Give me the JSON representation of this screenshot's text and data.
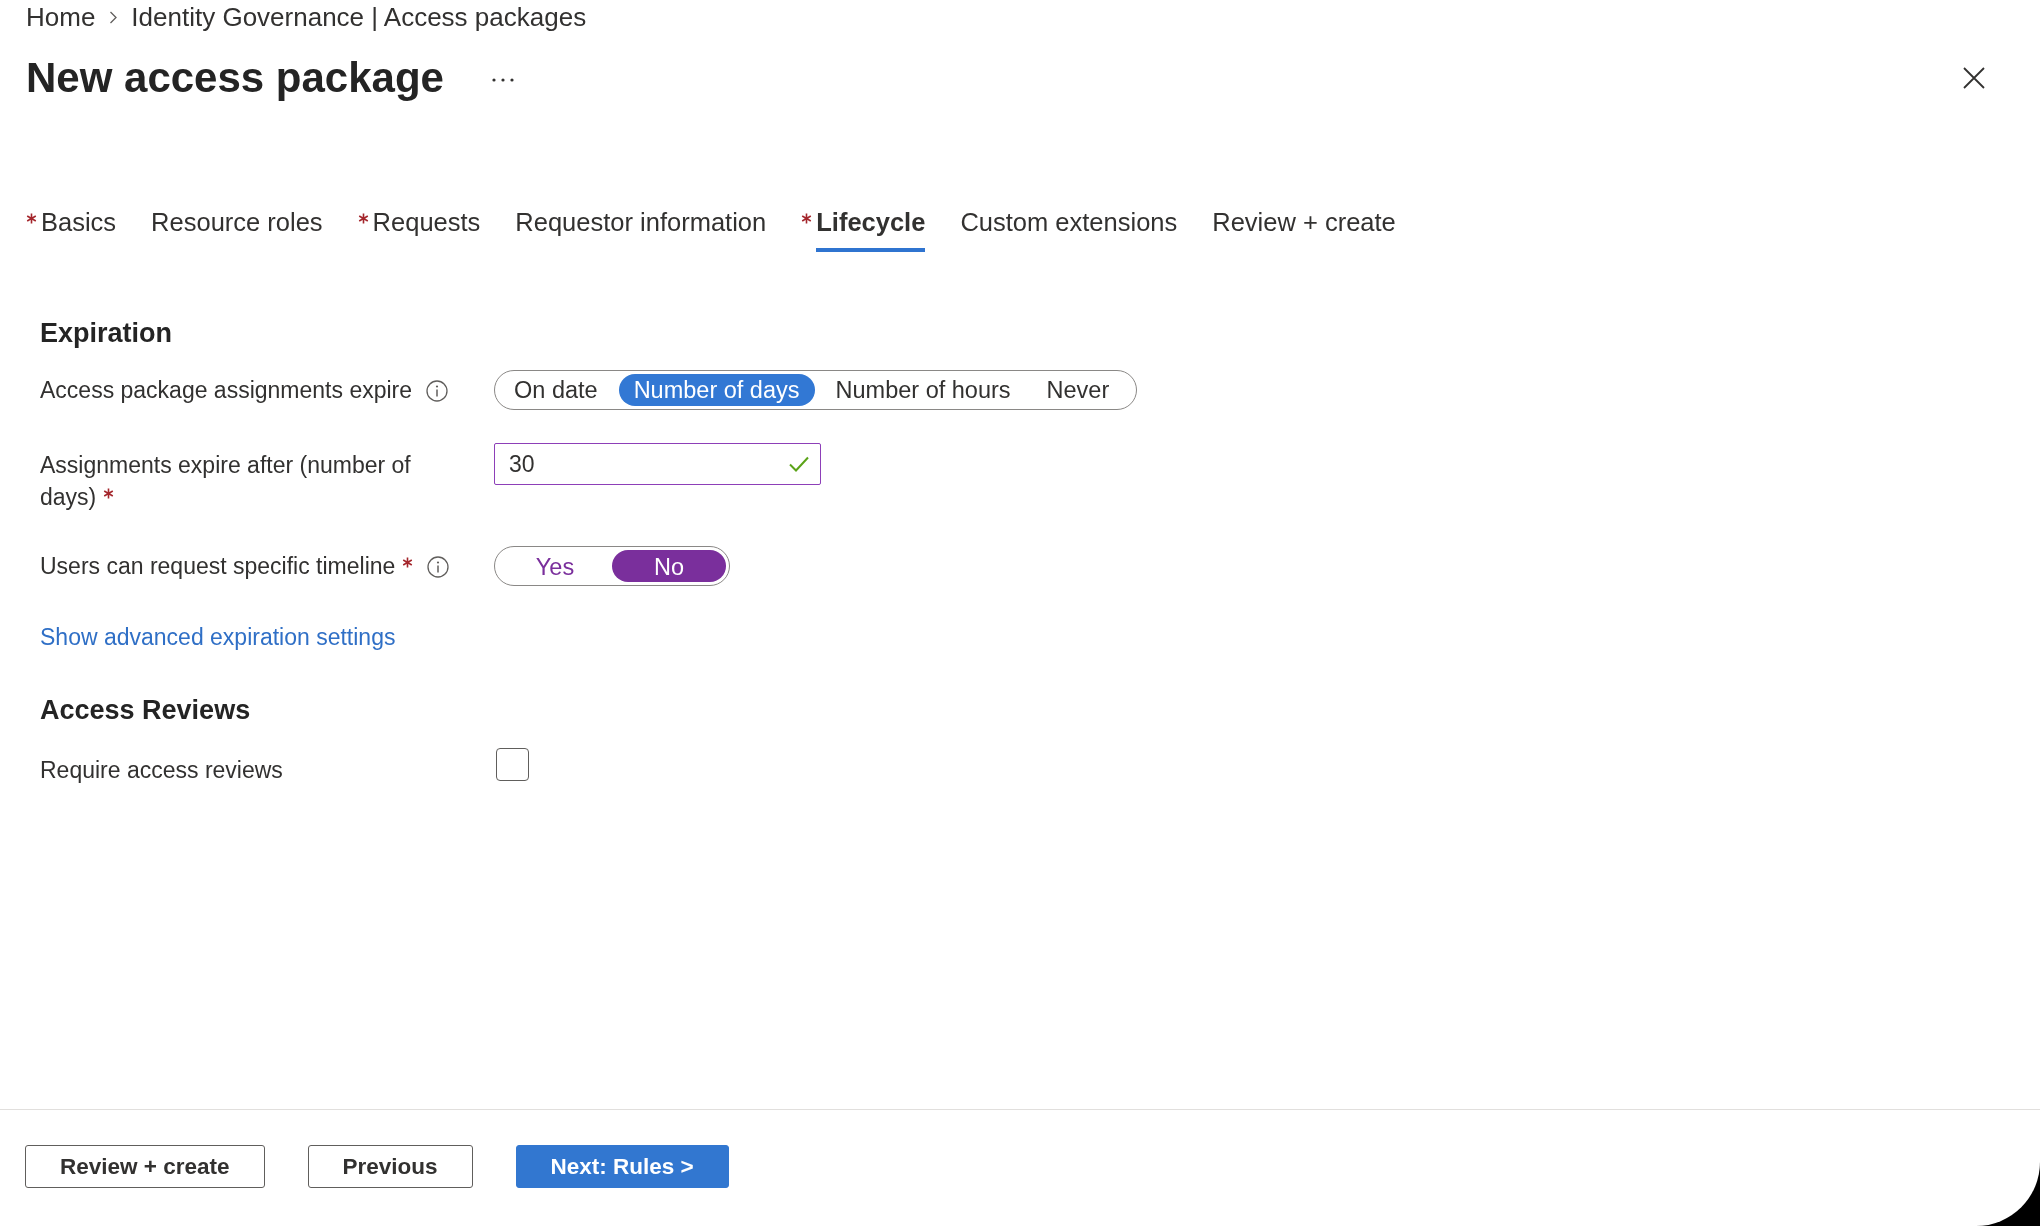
{
  "breadcrumb": [
    "Home",
    "Identity Governance | Access packages"
  ],
  "title": "New access package",
  "tabs": [
    {
      "label": "Basics",
      "required": true,
      "selected": false
    },
    {
      "label": "Resource roles",
      "required": false,
      "selected": false
    },
    {
      "label": "Requests",
      "required": true,
      "selected": false
    },
    {
      "label": "Requestor information",
      "required": false,
      "selected": false
    },
    {
      "label": "Lifecycle",
      "required": true,
      "selected": true
    },
    {
      "label": "Custom extensions",
      "required": false,
      "selected": false
    },
    {
      "label": "Review + create",
      "required": false,
      "selected": false
    }
  ],
  "sections": [
    {
      "heading": "Expiration",
      "fields": [
        {
          "kind": "segmented",
          "label": "Access package assignments expire",
          "info": true,
          "options": [
            {
              "label": "On date",
              "selected": false
            },
            {
              "label": "Number of days",
              "selected": true
            },
            {
              "label": "Number of hours",
              "selected": false
            },
            {
              "label": "Never",
              "selected": false
            }
          ]
        },
        {
          "kind": "text",
          "label": "Assignments expire after (number of days)",
          "required": true,
          "value": "30",
          "valid": true
        },
        {
          "kind": "toggle",
          "label": "Users can request specific timeline",
          "required": true,
          "info": true,
          "options": [
            {
              "label": "Yes",
              "selected": false
            },
            {
              "label": "No",
              "selected": true
            }
          ]
        },
        {
          "kind": "link",
          "label": "Show advanced expiration settings"
        }
      ]
    },
    {
      "heading": "Access Reviews",
      "fields": [
        {
          "kind": "checkbox",
          "label": "Require access reviews",
          "checked": false
        }
      ]
    }
  ],
  "footer_buttons": [
    {
      "label": "Review + create",
      "kind": "secondary"
    },
    {
      "label": "Previous",
      "kind": "secondary"
    },
    {
      "label": "Next: Rules >",
      "kind": "primary"
    }
  ]
}
